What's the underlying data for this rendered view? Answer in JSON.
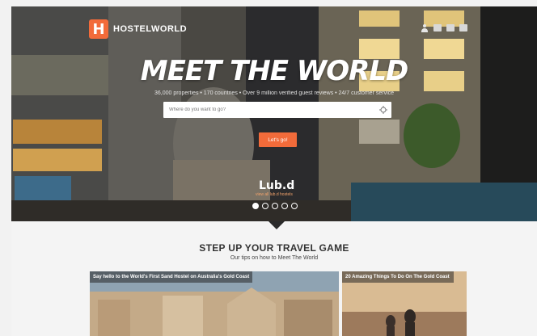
{
  "header": {
    "logo_letter": "H",
    "logo_text": "HOSTELWORLD",
    "icons": [
      "user-icon",
      "flag-icon",
      "currency-icon",
      "menu-icon"
    ]
  },
  "hero": {
    "headline": "MEET THE WORLD",
    "stats": "36,000 properties • 170 countries • Over 9 million verified guest reviews • 24/7 customer service",
    "search_placeholder": "Where do you want to go?",
    "cta_label": "Let's go!",
    "featured_brand": "Lub.d",
    "featured_sub": "view all lub.d hostels",
    "carousel_total": 5,
    "carousel_active": 1
  },
  "section": {
    "title": "STEP UP YOUR TRAVEL GAME",
    "subtitle": "Our tips on how to Meet The World"
  },
  "cards": [
    {
      "title": "Say hello to the World's First Sand Hostel on Australia's Gold Coast"
    },
    {
      "title": "20 Amazing Things To Do On The Gold Coast"
    }
  ],
  "colors": {
    "accent": "#f26b3a",
    "hero_dark": "#2a2a2a",
    "background": "#f4f4f4"
  }
}
